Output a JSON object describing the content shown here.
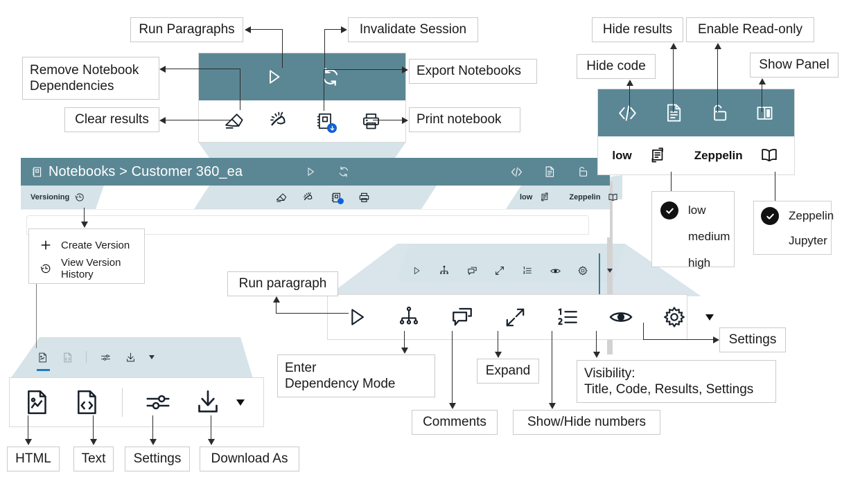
{
  "notebook": {
    "breadcrumb_root": "Notebooks",
    "breadcrumb_sep": ">",
    "breadcrumb_current": "Customer 360_ea",
    "title_full": "Notebooks > Customer 360_ea",
    "versioning_tab_label": "Versioning",
    "interpreter_level_label": "low",
    "notebook_kind_label": "Zeppelin"
  },
  "toolbar_top": {
    "run_paragraphs": "Run Paragraphs",
    "invalidate_session": "Invalidate Session",
    "remove_notebook_dependencies": "Remove Notebook\nDependencies",
    "export_notebooks": "Export Notebooks",
    "clear_results": "Clear results",
    "print_notebook": "Print notebook"
  },
  "toolbar_right": {
    "hide_code": "Hide code",
    "hide_results": "Hide results",
    "enable_read_only": "Enable Read-only",
    "show_panel": "Show Panel"
  },
  "versioning_menu": {
    "items": [
      {
        "label": "Create Version",
        "icon": "plus-icon"
      },
      {
        "label": "View Version History",
        "icon": "history-clock-icon"
      }
    ]
  },
  "level_menu": {
    "options": [
      {
        "label": "low",
        "selected": true
      },
      {
        "label": "medium",
        "selected": false
      },
      {
        "label": "high",
        "selected": false
      }
    ]
  },
  "kind_menu": {
    "options": [
      {
        "label": "Zeppelin",
        "selected": true
      },
      {
        "label": "Jupyter",
        "selected": false
      }
    ]
  },
  "paragraph_toolbar": {
    "run_paragraph": "Run paragraph",
    "enter_dependency_mode": "Enter\nDependency Mode",
    "comments": "Comments",
    "expand": "Expand",
    "show_hide_numbers": "Show/Hide numbers",
    "visibility": "Visibility:\nTitle, Code, Results, Settings",
    "settings": "Settings"
  },
  "results_toolbar": {
    "html": "HTML",
    "text": "Text",
    "settings": "Settings",
    "download_as": "Download As"
  },
  "colors": {
    "teal_header": "#5b8795",
    "teal_header_dark": "#507f8e",
    "funnel_fill": "#d6e3e8",
    "accent_blue": "#1f7bbf",
    "badge_blue": "#0f62d6",
    "callout_border": "#c9c9c9",
    "line": "#2b2b2b"
  },
  "icons": {
    "run": "play-triangle-icon",
    "invalidate": "refresh-cycle-icon",
    "clear": "eraser-icon",
    "remove_deps": "remove-dependency-icon",
    "export": "notebook-download-icon",
    "print": "printer-icon",
    "code": "code-brackets-icon",
    "results": "document-lines-icon",
    "readonly": "unlock-padlock-icon",
    "panel": "split-panel-icon",
    "level": "interpreter-loop-icon",
    "kind": "open-book-icon",
    "versioning": "history-clock-icon",
    "dependency": "hierarchy-tree-icon",
    "comment": "speech-bubbles-icon",
    "expand": "diagonal-arrows-icon",
    "numbers": "ordered-list-icon",
    "visibility": "eye-icon",
    "settings": "gear-icon",
    "dropdown": "caret-down-icon",
    "html_result": "image-document-icon",
    "text_result": "code-document-icon",
    "result_settings": "sliders-icon",
    "download": "download-tray-icon"
  }
}
